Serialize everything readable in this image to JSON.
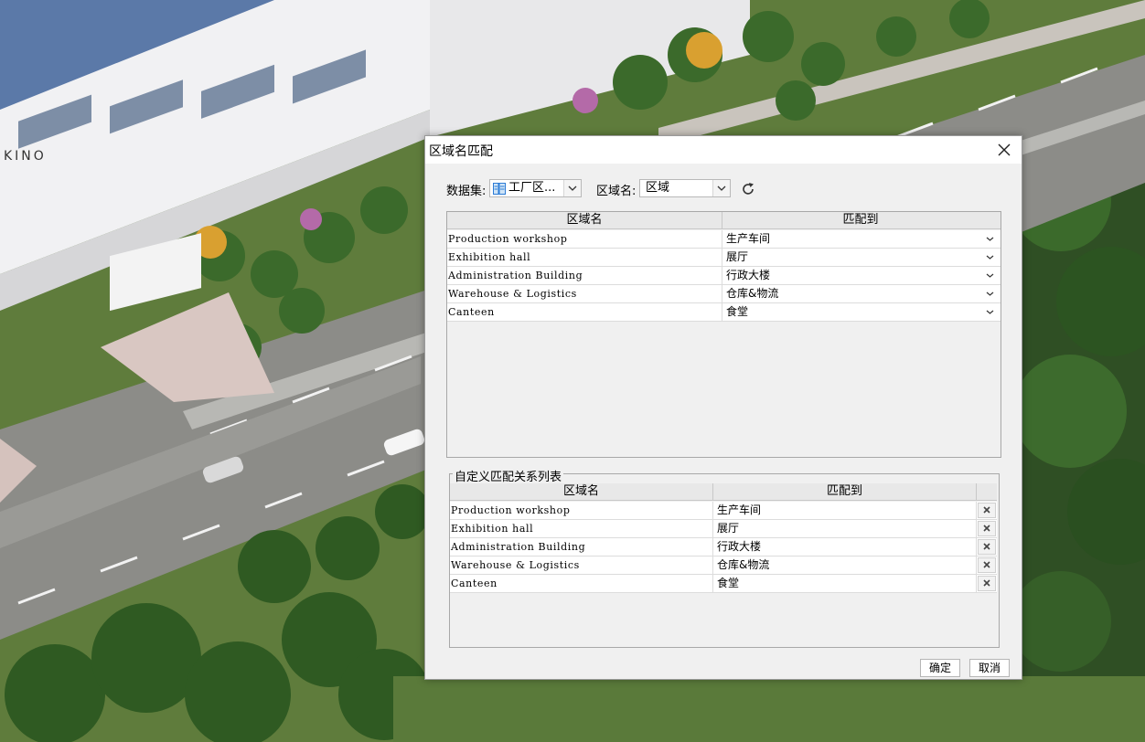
{
  "dialog": {
    "title": "区域名匹配",
    "dataset_label": "数据集:",
    "dataset_value": "工厂区...",
    "region_label": "区域名:",
    "region_value": "区域",
    "ok_label": "确定",
    "cancel_label": "取消"
  },
  "match_table": {
    "headers": [
      "区域名",
      "匹配到"
    ],
    "rows": [
      {
        "name": "Production workshop",
        "match": "生产车间"
      },
      {
        "name": "Exhibition hall",
        "match": "展厅"
      },
      {
        "name": "Administration Building",
        "match": "行政大楼"
      },
      {
        "name": "Warehouse & Logistics",
        "match": "仓库&物流"
      },
      {
        "name": "Canteen",
        "match": "食堂"
      }
    ]
  },
  "custom_table": {
    "group_title": "自定义匹配关系列表",
    "headers": [
      "区域名",
      "匹配到"
    ],
    "rows": [
      {
        "name": "Production workshop",
        "match": "生产车间"
      },
      {
        "name": "Exhibition hall",
        "match": "展厅"
      },
      {
        "name": "Administration Building",
        "match": "行政大楼"
      },
      {
        "name": "Warehouse & Logistics",
        "match": "仓库&物流"
      },
      {
        "name": "Canteen",
        "match": "食堂"
      }
    ]
  },
  "scene": {
    "building_sign": "KINO"
  },
  "colors": {
    "dialog_bg": "#f0f0f0",
    "header_bg": "#e8e8e8",
    "border": "#a8a8a8",
    "grass": "#4f7a32",
    "road": "#8a8a86",
    "tree_dark": "#2e5a23"
  },
  "icons": {
    "close": "close-icon",
    "dataset": "dataset-icon",
    "dropdown": "chevron-down-icon",
    "refresh": "refresh-icon",
    "delete": "delete-x-icon"
  }
}
